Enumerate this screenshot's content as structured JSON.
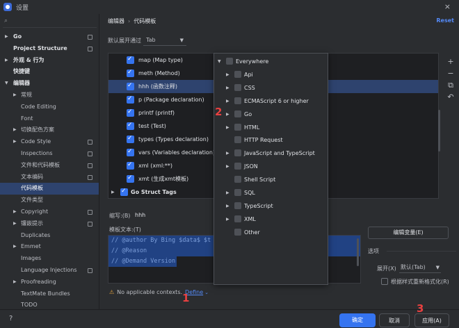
{
  "window": {
    "title": "设置",
    "close_icon": "×"
  },
  "search": {
    "icon": "search-icon",
    "placeholder": ""
  },
  "sidebar": {
    "items": [
      {
        "label": "Go",
        "arrow": "▶",
        "bold": true,
        "cfg": true
      },
      {
        "label": "Project Structure",
        "arrow": "",
        "bold": true,
        "cfg": true
      },
      {
        "label": "外观 & 行为",
        "arrow": "▶",
        "bold": true,
        "cfg": false
      },
      {
        "label": "快捷键",
        "arrow": "",
        "bold": true,
        "cfg": false
      },
      {
        "label": "编辑器",
        "arrow": "▼",
        "bold": true,
        "cfg": false
      },
      {
        "label": "常规",
        "arrow": "▶",
        "bold": false,
        "cfg": false
      },
      {
        "label": "Code Editing",
        "arrow": "",
        "bold": false,
        "cfg": false
      },
      {
        "label": "Font",
        "arrow": "",
        "bold": false,
        "cfg": false
      },
      {
        "label": "切换配色方案",
        "arrow": "▶",
        "bold": false,
        "cfg": false
      },
      {
        "label": "Code Style",
        "arrow": "▶",
        "bold": false,
        "cfg": true
      },
      {
        "label": "Inspections",
        "arrow": "",
        "bold": false,
        "cfg": true
      },
      {
        "label": "文件和代码模板",
        "arrow": "",
        "bold": false,
        "cfg": true
      },
      {
        "label": "文本编码",
        "arrow": "",
        "bold": false,
        "cfg": true
      },
      {
        "label": "代码模板",
        "arrow": "",
        "bold": false,
        "cfg": false,
        "selected": true
      },
      {
        "label": "文件类型",
        "arrow": "",
        "bold": false,
        "cfg": false
      },
      {
        "label": "Copyright",
        "arrow": "▶",
        "bold": false,
        "cfg": true
      },
      {
        "label": "镶嵌提示",
        "arrow": "▶",
        "bold": false,
        "cfg": true
      },
      {
        "label": "Duplicates",
        "arrow": "",
        "bold": false,
        "cfg": false
      },
      {
        "label": "Emmet",
        "arrow": "▶",
        "bold": false,
        "cfg": false
      },
      {
        "label": "Images",
        "arrow": "",
        "bold": false,
        "cfg": false
      },
      {
        "label": "Language Injections",
        "arrow": "",
        "bold": false,
        "cfg": true
      },
      {
        "label": "Proofreading",
        "arrow": "▶",
        "bold": false,
        "cfg": false
      },
      {
        "label": "TextMate Bundles",
        "arrow": "",
        "bold": false,
        "cfg": false
      },
      {
        "label": "TODO",
        "arrow": "",
        "bold": false,
        "cfg": false
      }
    ]
  },
  "header": {
    "breadcrumb_parent": "编辑器",
    "breadcrumb_sep": "›",
    "breadcrumb_current": "代码模板",
    "reset": "Reset"
  },
  "expand": {
    "label": "默认展开通过",
    "value": "Tab",
    "dropdown_icon": "▼"
  },
  "templates": [
    {
      "label": "map (Map type)",
      "selected": false
    },
    {
      "label": "meth (Method)",
      "selected": false
    },
    {
      "label": "hhh (函数注释)",
      "selected": true
    },
    {
      "label": "p (Package declaration)",
      "selected": false
    },
    {
      "label": "printf (printf)",
      "selected": false
    },
    {
      "label": "test (Test)",
      "selected": false
    },
    {
      "label": "types (Types declaration)",
      "selected": false
    },
    {
      "label": "vars (Variables declaration)",
      "selected": false
    },
    {
      "label": "xml (xml:**)",
      "selected": false
    },
    {
      "label": "xmt (生成xmt模板)",
      "selected": false
    }
  ],
  "group": {
    "label": "Go Struct Tags",
    "arrow": "▶"
  },
  "tools": {
    "add": "+",
    "remove": "−",
    "copy": "⧉",
    "undo": "↶"
  },
  "abbreviation": {
    "label": "缩写:(B)",
    "value": "hhh"
  },
  "template_text": {
    "label": "模板文本:(T)",
    "lines": [
      "// @author By Bing $data$ $t",
      "// @Reason",
      "// @Demand Version"
    ]
  },
  "edit_vars": "编辑变量(E)",
  "options": {
    "label": "选项",
    "expand_label": "展开(X)",
    "expand_value": "默认(Tab)",
    "dropdown_icon": "▼",
    "reformat_label": "根据样式重新格式化(R)"
  },
  "warning": {
    "icon": "⚠",
    "text": "No applicable contexts.",
    "define": "Define",
    "dropdown_icon": "⌄"
  },
  "contexts": [
    {
      "label": "Everywhere",
      "arrow": "▼",
      "indent": 0
    },
    {
      "label": "Api",
      "arrow": "▶",
      "indent": 1
    },
    {
      "label": "CSS",
      "arrow": "▶",
      "indent": 1
    },
    {
      "label": "ECMAScript 6 or higher",
      "arrow": "▶",
      "indent": 1
    },
    {
      "label": "Go",
      "arrow": "▶",
      "indent": 1
    },
    {
      "label": "HTML",
      "arrow": "▶",
      "indent": 1
    },
    {
      "label": "HTTP Request",
      "arrow": "",
      "indent": 1
    },
    {
      "label": "JavaScript and TypeScript",
      "arrow": "▶",
      "indent": 1
    },
    {
      "label": "JSON",
      "arrow": "▶",
      "indent": 1
    },
    {
      "label": "Shell Script",
      "arrow": "",
      "indent": 1
    },
    {
      "label": "SQL",
      "arrow": "▶",
      "indent": 1
    },
    {
      "label": "TypeScript",
      "arrow": "▶",
      "indent": 1
    },
    {
      "label": "XML",
      "arrow": "▶",
      "indent": 1
    },
    {
      "label": "Other",
      "arrow": "",
      "indent": 1
    }
  ],
  "buttons": {
    "help": "?",
    "ok": "确定",
    "cancel": "取消",
    "apply": "应用(A)"
  },
  "markers": {
    "one": "1",
    "two": "2",
    "three": "3"
  },
  "colors": {
    "accent": "#3574f0",
    "selection": "#2e436e",
    "link": "#548af7",
    "marker": "#e84040"
  }
}
